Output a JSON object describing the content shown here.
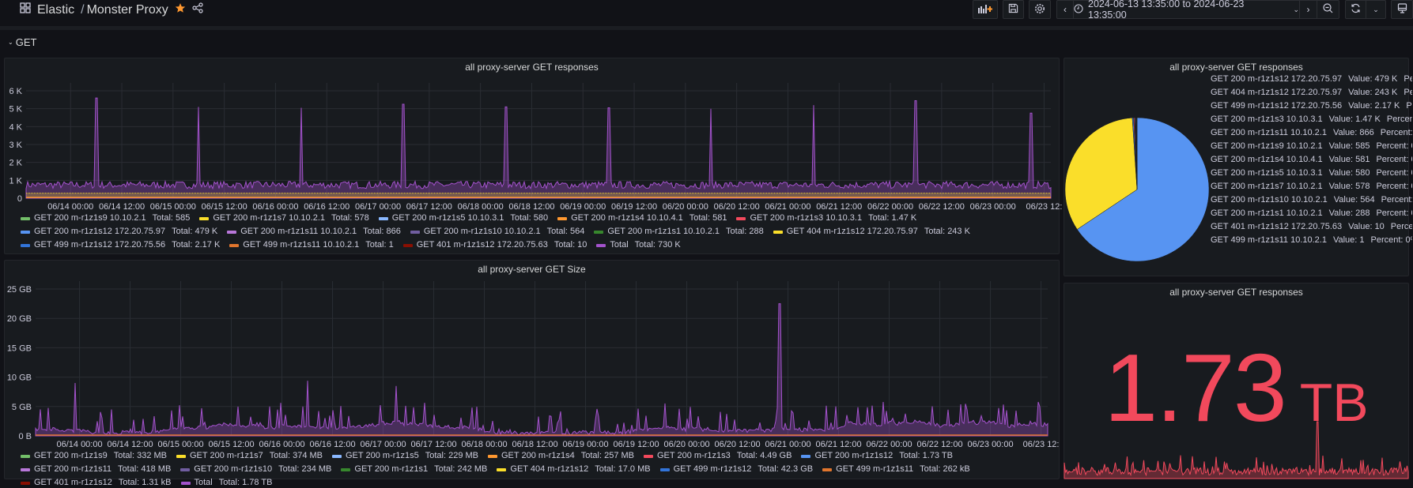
{
  "header": {
    "folder": "Elastic",
    "separator": "/",
    "dashboard": "Monster Proxy",
    "starred": true,
    "time_range": "2024-06-13 13:35:00 to 2024-06-23 13:35:00",
    "icons": [
      "apps-icon",
      "star-icon",
      "share-icon",
      "add-panel-icon",
      "save-icon",
      "settings-icon",
      "chevron-left-icon",
      "clock-icon",
      "chevron-down-icon",
      "chevron-right-icon",
      "zoom-out-icon",
      "refresh-icon",
      "chevron-down-icon",
      "tv-icon"
    ]
  },
  "row": {
    "title": "GET"
  },
  "colors": {
    "accent": "#FF9830",
    "stat": "#F2495C",
    "total": "#A352CC"
  },
  "panels": {
    "responses": {
      "title": "all proxy-server GET responses",
      "legend": [
        {
          "label": "GET 200 m-r1z1s9 10.10.2.1",
          "stat": "Total: 585",
          "color": "#73BF69"
        },
        {
          "label": "GET 200 m-r1z1s7 10.10.2.1",
          "stat": "Total: 578",
          "color": "#FADE2A"
        },
        {
          "label": "GET 200 m-r1z1s5 10.10.3.1",
          "stat": "Total: 580",
          "color": "#8AB8FF"
        },
        {
          "label": "GET 200 m-r1z1s4 10.10.4.1",
          "stat": "Total: 581",
          "color": "#FF9830"
        },
        {
          "label": "GET 200 m-r1z1s3 10.10.3.1",
          "stat": "Total: 1.47 K",
          "color": "#F2495C"
        },
        {
          "label": "GET 200 m-r1z1s12 172.20.75.97",
          "stat": "Total: 479 K",
          "color": "#5794F2"
        },
        {
          "label": "GET 200 m-r1z1s11 10.10.2.1",
          "stat": "Total: 866",
          "color": "#B877D9"
        },
        {
          "label": "GET 200 m-r1z1s10 10.10.2.1",
          "stat": "Total: 564",
          "color": "#705DA0"
        },
        {
          "label": "GET 200 m-r1z1s1 10.10.2.1",
          "stat": "Total: 288",
          "color": "#37872D"
        },
        {
          "label": "GET 404 m-r1z1s12 172.20.75.97",
          "stat": "Total: 243 K",
          "color": "#FADE2A"
        },
        {
          "label": "GET 499 m-r1z1s12 172.20.75.56",
          "stat": "Total: 2.17 K",
          "color": "#3274D9"
        },
        {
          "label": "GET 499 m-r1z1s11 10.10.2.1",
          "stat": "Total: 1",
          "color": "#E0752D"
        },
        {
          "label": "GET 401 m-r1z1s12 172.20.75.63",
          "stat": "Total: 10",
          "color": "#890F02"
        },
        {
          "label": "Total",
          "stat": "Total: 730 K",
          "color": "#A352CC"
        }
      ]
    },
    "size": {
      "title": "all proxy-server GET Size",
      "legend": [
        {
          "label": "GET 200 m-r1z1s9",
          "stat": "Total: 332 MB",
          "color": "#73BF69"
        },
        {
          "label": "GET 200 m-r1z1s7",
          "stat": "Total: 374 MB",
          "color": "#FADE2A"
        },
        {
          "label": "GET 200 m-r1z1s5",
          "stat": "Total: 229 MB",
          "color": "#8AB8FF"
        },
        {
          "label": "GET 200 m-r1z1s4",
          "stat": "Total: 257 MB",
          "color": "#FF9830"
        },
        {
          "label": "GET 200 m-r1z1s3",
          "stat": "Total: 4.49 GB",
          "color": "#F2495C"
        },
        {
          "label": "GET 200 m-r1z1s12",
          "stat": "Total: 1.73 TB",
          "color": "#5794F2"
        },
        {
          "label": "GET 200 m-r1z1s11",
          "stat": "Total: 418 MB",
          "color": "#B877D9"
        },
        {
          "label": "GET 200 m-r1z1s10",
          "stat": "Total: 234 MB",
          "color": "#705DA0"
        },
        {
          "label": "GET 200 m-r1z1s1",
          "stat": "Total: 242 MB",
          "color": "#37872D"
        },
        {
          "label": "GET 404 m-r1z1s12",
          "stat": "Total: 17.0 MB",
          "color": "#FADE2A"
        },
        {
          "label": "GET 499 m-r1z1s12",
          "stat": "Total: 42.3 GB",
          "color": "#3274D9"
        },
        {
          "label": "GET 499 m-r1z1s11",
          "stat": "Total: 262 kB",
          "color": "#E0752D"
        },
        {
          "label": "GET 401 m-r1z1s12",
          "stat": "Total: 1.31 kB",
          "color": "#890F02"
        },
        {
          "label": "Total",
          "stat": "Total: 1.78 TB",
          "color": "#A352CC"
        }
      ]
    },
    "pie": {
      "title": "all proxy-server GET responses",
      "legend": [
        {
          "label": "GET 200 m-r1z1s12 172.20.75.97",
          "value": "Value: 479 K",
          "percent": "Percen",
          "num": 479000,
          "color": "#5794F2"
        },
        {
          "label": "GET 404 m-r1z1s12 172.20.75.97",
          "value": "Value: 243 K",
          "percent": "Percer",
          "num": 243000,
          "color": "#FADE2A"
        },
        {
          "label": "GET 499 m-r1z1s12 172.20.75.56",
          "value": "Value: 2.17 K",
          "percent": "Percer",
          "num": 2170,
          "color": "#3274D9"
        },
        {
          "label": "GET 200 m-r1z1s3 10.10.3.1",
          "value": "Value: 1.47 K",
          "percent": "Percent: 0%",
          "num": 1470,
          "color": "#F2495C"
        },
        {
          "label": "GET 200 m-r1z1s11 10.10.2.1",
          "value": "Value: 866",
          "percent": "Percent: 0%",
          "num": 866,
          "color": "#B877D9"
        },
        {
          "label": "GET 200 m-r1z1s9 10.10.2.1",
          "value": "Value: 585",
          "percent": "Percent: 0%",
          "num": 585,
          "color": "#73BF69"
        },
        {
          "label": "GET 200 m-r1z1s4 10.10.4.1",
          "value": "Value: 581",
          "percent": "Percent: 0%",
          "num": 581,
          "color": "#FF9830"
        },
        {
          "label": "GET 200 m-r1z1s5 10.10.3.1",
          "value": "Value: 580",
          "percent": "Percent: 0%",
          "num": 580,
          "color": "#8AB8FF"
        },
        {
          "label": "GET 200 m-r1z1s7 10.10.2.1",
          "value": "Value: 578",
          "percent": "Percent: 0%",
          "num": 578,
          "color": "#FADE2A"
        },
        {
          "label": "GET 200 m-r1z1s10 10.10.2.1",
          "value": "Value: 564",
          "percent": "Percent: 0%",
          "num": 564,
          "color": "#705DA0"
        },
        {
          "label": "GET 200 m-r1z1s1 10.10.2.1",
          "value": "Value: 288",
          "percent": "Percent: 0%",
          "num": 288,
          "color": "#37872D"
        },
        {
          "label": "GET 401 m-r1z1s12 172.20.75.63",
          "value": "Value: 10",
          "percent": "Percent: 0",
          "num": 10,
          "color": "#890F02"
        },
        {
          "label": "GET 499 m-r1z1s11 10.10.2.1",
          "value": "Value: 1",
          "percent": "Percent: 0%",
          "num": 1,
          "color": "#E0752D"
        }
      ]
    },
    "stat": {
      "title": "all proxy-server GET responses",
      "value": "1.73",
      "unit": "TB"
    }
  },
  "chart_data": [
    {
      "type": "line",
      "title": "all proxy-server GET responses",
      "xrange": [
        "2024-06-13 13:35",
        "2024-06-23 13:35"
      ],
      "xticks": [
        "06/14 00:00",
        "06/14 12:00",
        "06/15 00:00",
        "06/15 12:00",
        "06/16 00:00",
        "06/16 12:00",
        "06/17 00:00",
        "06/17 12:00",
        "06/18 00:00",
        "06/18 12:00",
        "06/19 00:00",
        "06/19 12:00",
        "06/20 00:00",
        "06/20 12:00",
        "06/21 00:00",
        "06/21 12:00",
        "06/22 00:00",
        "06/22 12:00",
        "06/23 00:00",
        "06/23 12:"
      ],
      "yticks": [
        "0",
        "1 K",
        "2 K",
        "3 K",
        "4 K",
        "5 K",
        "6 K"
      ],
      "ylim": [
        0,
        6000
      ],
      "grid": true,
      "baseline_total": 900,
      "total_peaks": [
        {
          "x": "2024-06-14 06:00",
          "y": 5600
        },
        {
          "x": "2024-06-15 06:00",
          "y": 5100
        },
        {
          "x": "2024-06-16 06:00",
          "y": 5050
        },
        {
          "x": "2024-06-17 06:00",
          "y": 5250
        },
        {
          "x": "2024-06-18 06:00",
          "y": 5100
        },
        {
          "x": "2024-06-19 06:00",
          "y": 5050
        },
        {
          "x": "2024-06-20 06:00",
          "y": 5000
        },
        {
          "x": "2024-06-21 06:00",
          "y": 5200
        },
        {
          "x": "2024-06-22 06:00",
          "y": 5450
        },
        {
          "x": "2024-06-23 09:00",
          "y": 4750
        }
      ],
      "legend": "bottom"
    },
    {
      "type": "line",
      "title": "all proxy-server GET Size",
      "xrange": [
        "2024-06-13 13:35",
        "2024-06-23 13:35"
      ],
      "xticks": [
        "06/14 00:00",
        "06/14 12:00",
        "06/15 00:00",
        "06/15 12:00",
        "06/16 00:00",
        "06/16 12:00",
        "06/17 00:00",
        "06/17 12:00",
        "06/18 00:00",
        "06/18 12:00",
        "06/19 00:00",
        "06/19 12:00",
        "06/20 00:00",
        "06/20 12:00",
        "06/21 00:00",
        "06/21 12:00",
        "06/22 00:00",
        "06/22 12:00",
        "06/23 00:00",
        "06/23 12:"
      ],
      "yticks": [
        "0 B",
        "5 GB",
        "10 GB",
        "15 GB",
        "20 GB",
        "25 GB"
      ],
      "ylim": [
        0,
        25
      ],
      "grid": true,
      "peaks": [
        {
          "x": "2024-06-13 23:00",
          "y": 9.0
        },
        {
          "x": "2024-06-16 06:00",
          "y": 9.4
        },
        {
          "x": "2024-06-17 03:00",
          "y": 8.5
        },
        {
          "x": "2024-06-20 22:00",
          "y": 22.5
        }
      ],
      "legend": "bottom"
    },
    {
      "type": "pie",
      "title": "all proxy-server GET responses",
      "legend": "right"
    }
  ]
}
